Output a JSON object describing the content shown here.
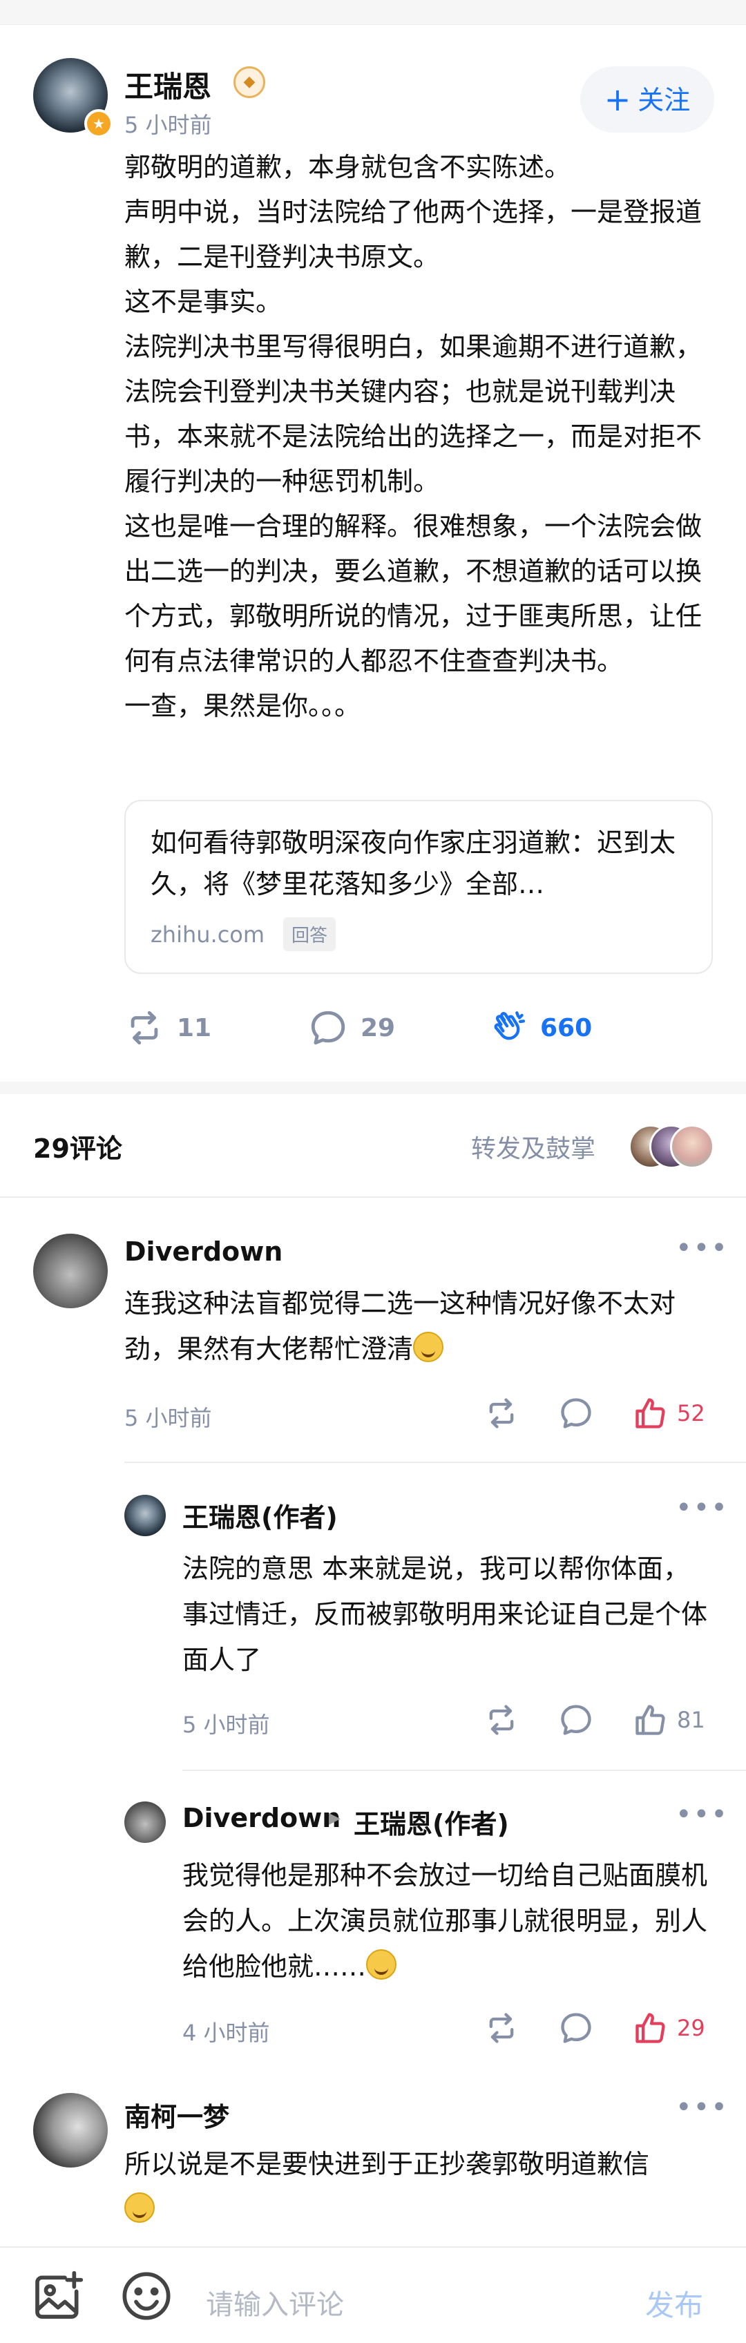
{
  "post": {
    "author": "王瑞恩",
    "time": "5 小时前",
    "follow_label": "关注",
    "paragraphs": [
      "郭敬明的道歉，本身就包含不实陈述。",
      "声明中说，当时法院给了他两个选择，一是登报道歉，二是刊登判决书原文。",
      "这不是事实。",
      "法院判决书里写得很明白，如果逾期不进行道歉，法院会刊登判决书关键内容；也就是说刊载判决书，本来就不是法院给出的选择之一，而是对拒不履行判决的一种惩罚机制。",
      "这也是唯一合理的解释。很难想象，一个法院会做出二选一的判决，要么道歉，不想道歉的话可以换个方式，郭敬明所说的情况，过于匪夷所思，让任何有点法律常识的人都忍不住查查判决书。",
      "一查，果然是你。。。"
    ],
    "link_card": {
      "title": "如何看待郭敬明深夜向作家庄羽道歉：迟到太久，将《梦里花落知多少》全部…",
      "domain": "zhihu.com",
      "tag": "回答"
    },
    "actions": {
      "repost_count": "11",
      "comment_count": "29",
      "applause_count": "660"
    }
  },
  "comments_header": {
    "count_label": "29评论",
    "repost_label": "转发及鼓掌"
  },
  "comments": [
    {
      "author": "Diverdown",
      "text": "连我这种法盲都觉得二选一这种情况好像不太对劲，果然有大佬帮忙澄清",
      "time": "5 小时前",
      "likes": "52"
    },
    {
      "author": "王瑞恩(作者)",
      "text": "法院的意思 本来就是说，我可以帮你体面，事过情迁，反而被郭敬明用来论证自己是个体面人了",
      "time": "5 小时前",
      "likes": "81"
    },
    {
      "author": "Diverdown",
      "reply_to": "王瑞恩(作者)",
      "text": "我觉得他是那种不会放过一切给自己贴面膜机会的人。上次演员就位那事儿就很明显，别人给他脸他就……",
      "time": "4 小时前",
      "likes": "29"
    },
    {
      "author": "南柯一梦",
      "text": "所以说是不是要快进到于正抄袭郭敬明道歉信"
    }
  ],
  "bottom_bar": {
    "placeholder": "请输入评论",
    "send_label": "发布"
  },
  "colors": {
    "brand_blue": "#1772f6",
    "like_red": "#e33f5c",
    "meta_gray": "#8590a6"
  }
}
